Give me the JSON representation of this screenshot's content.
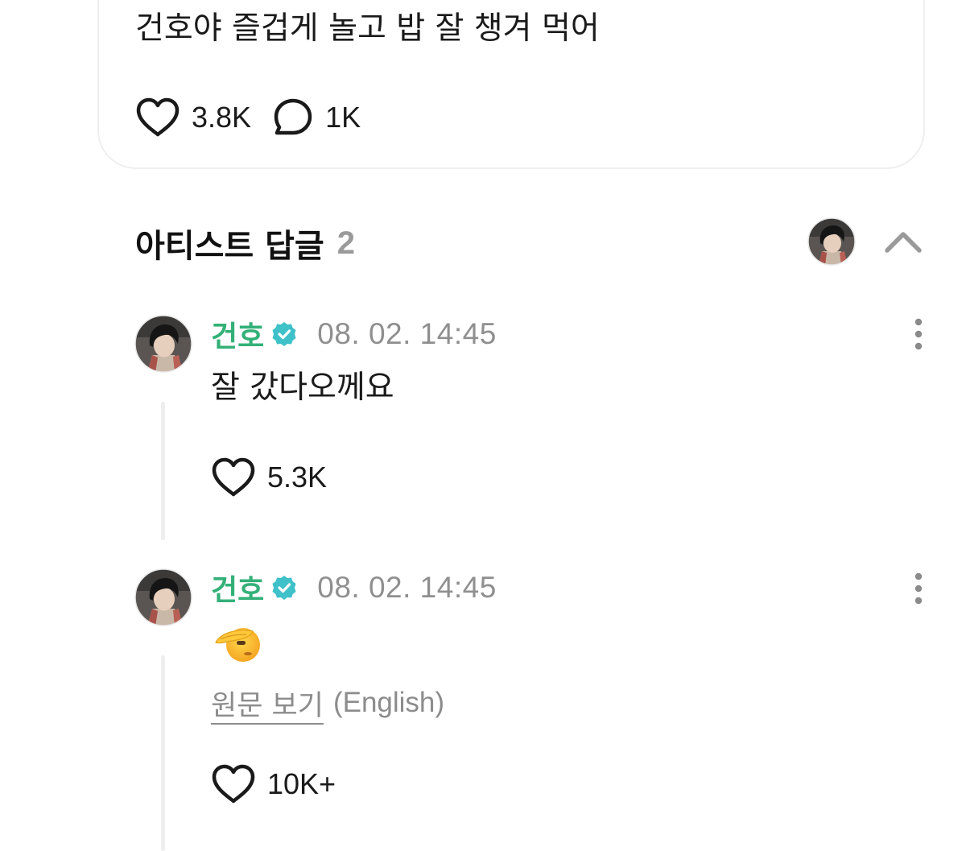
{
  "post": {
    "text": "건호야 즐겁게 놀고 밥 잘 챙겨 먹어",
    "likes": "3.8K",
    "comments": "1K"
  },
  "section": {
    "title": "아티스트 답글",
    "count": "2"
  },
  "replies": [
    {
      "author": "건호",
      "timestamp": "08. 02. 14:45",
      "text": "잘 갔다오께요",
      "likes": "5.3K"
    },
    {
      "author": "건호",
      "timestamp": "08. 02. 14:45",
      "emoji": "saluting-face-emoji",
      "translate_link": "원문 보기",
      "translate_lang": "(English)",
      "likes": "10K+"
    }
  ],
  "icons": {
    "like": "heart-outline-icon",
    "comment": "speech-bubble-icon",
    "verified": "verified-badge-icon",
    "more": "vertical-ellipsis-icon",
    "collapse": "chevron-up-icon"
  },
  "colors": {
    "author_name": "#33b078",
    "verified_badge": "#3fc1c9",
    "timestamp": "#8f8f8f",
    "section_count": "#9a9a9a",
    "thread_line": "#eeeeee"
  }
}
